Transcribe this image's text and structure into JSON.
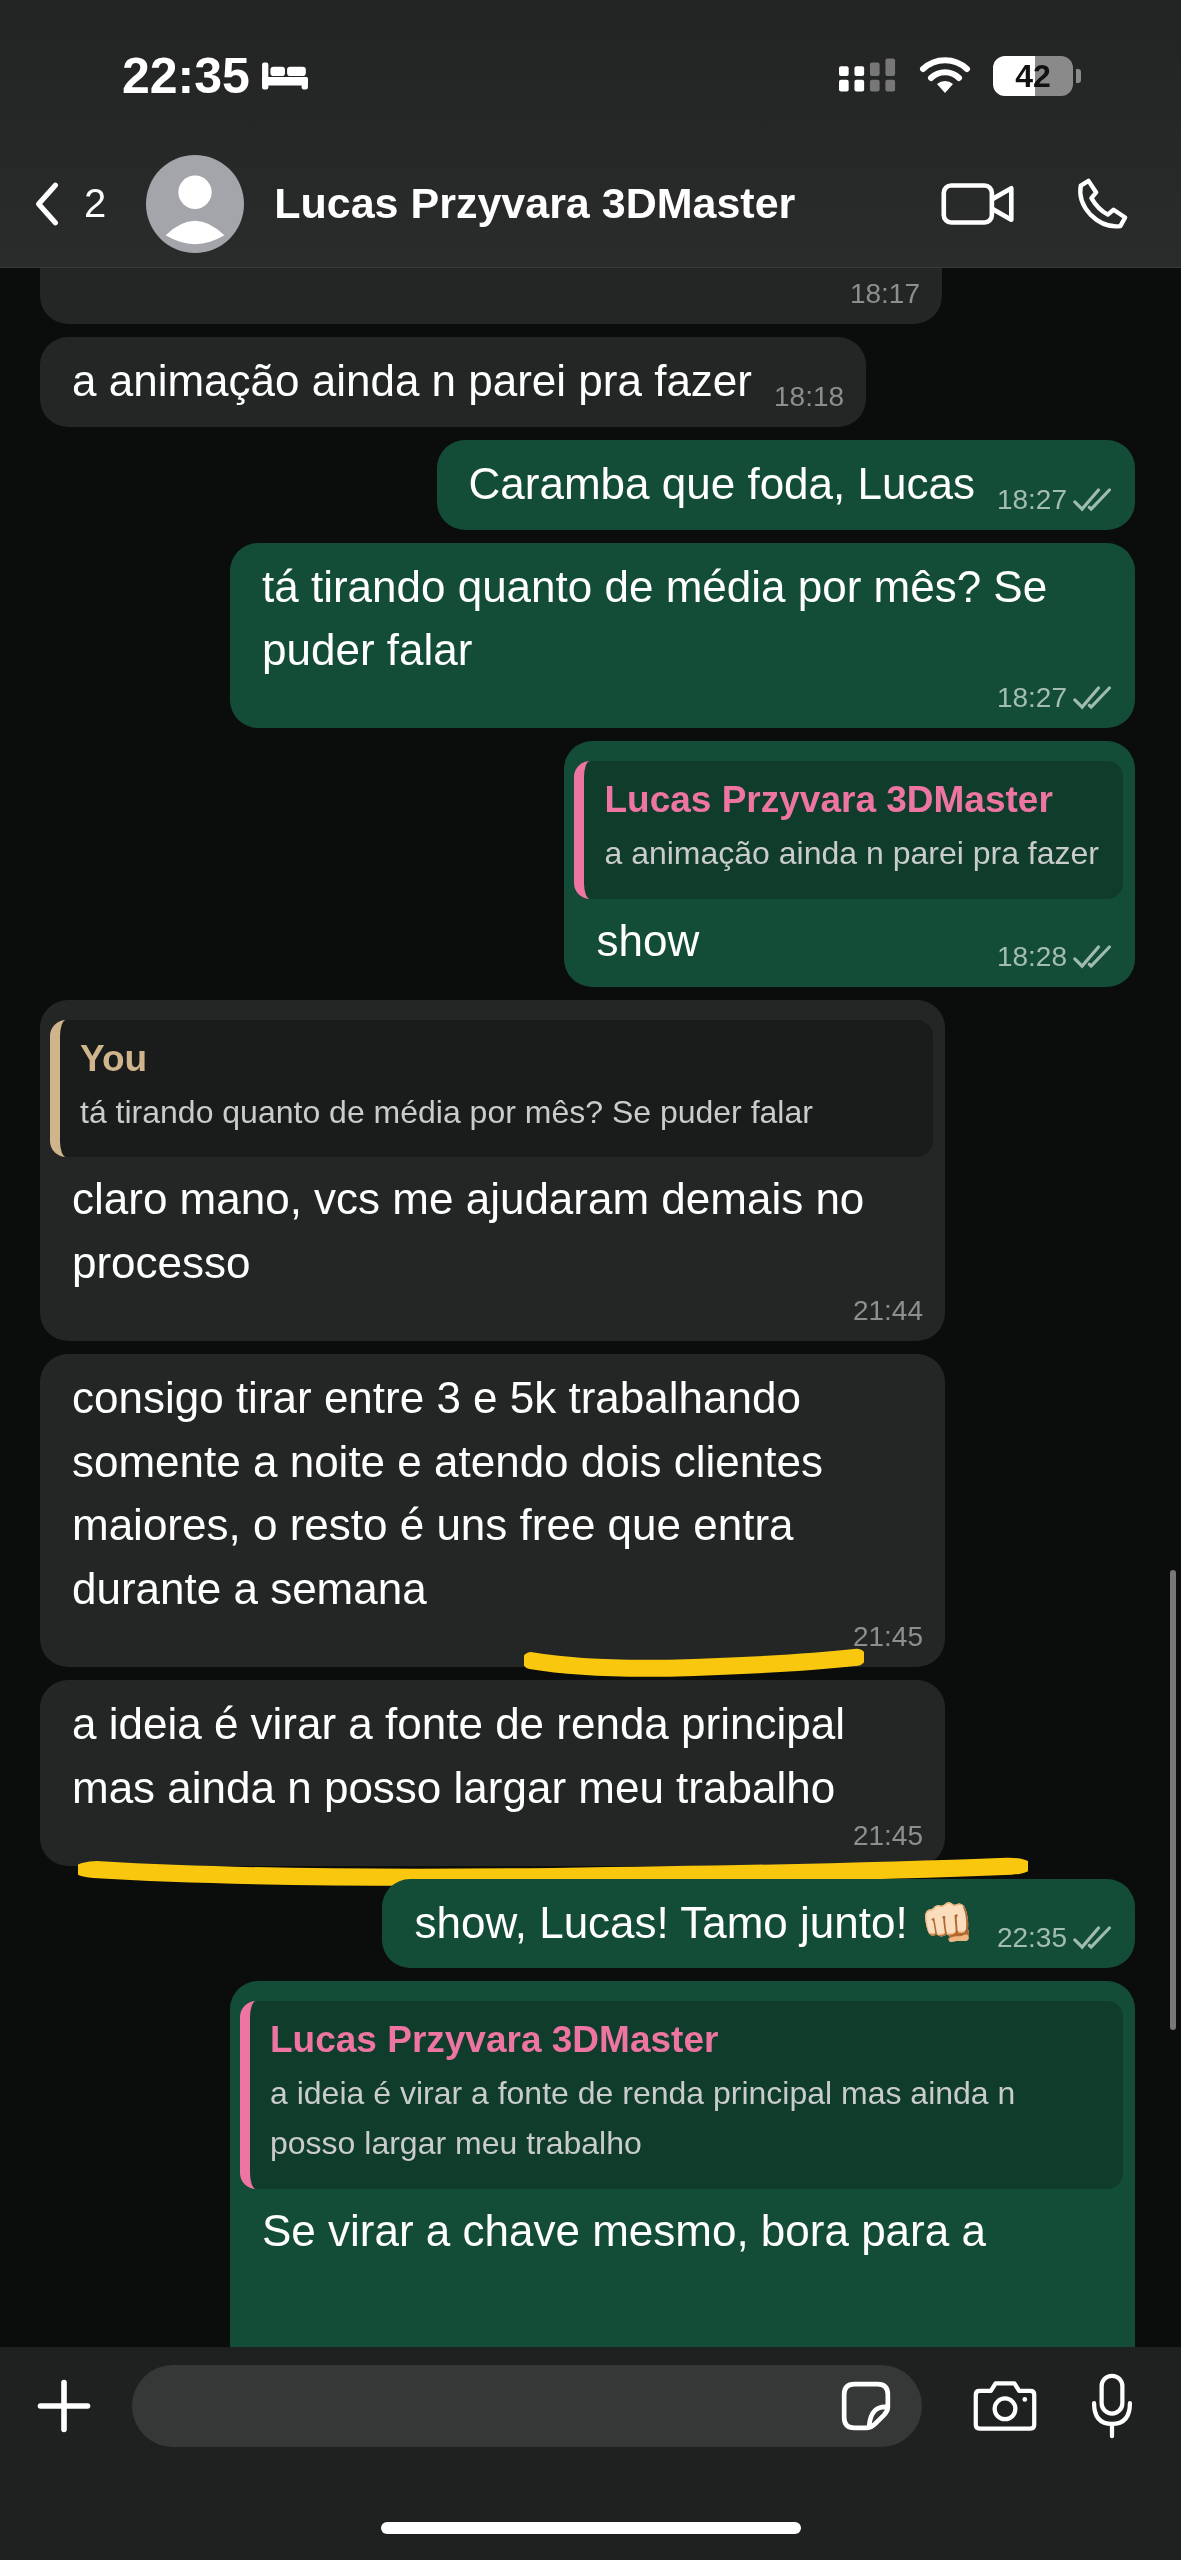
{
  "status_bar": {
    "time": "22:35",
    "battery": "42"
  },
  "header": {
    "back_count": "2",
    "contact_name": "Lucas Przyvara 3DMaster"
  },
  "messages": [
    {
      "outgoing": false,
      "kind": "cut",
      "time": "18:17",
      "highlighted": false
    },
    {
      "outgoing": false,
      "kind": "text",
      "text": "a animação ainda n parei pra fazer",
      "time": "18:18",
      "highlighted": false
    },
    {
      "outgoing": true,
      "kind": "text",
      "text": "Caramba que foda, Lucas",
      "time": "18:27",
      "delivered": true,
      "highlighted": false
    },
    {
      "outgoing": true,
      "kind": "text",
      "text": "tá tirando quanto de média por mês? Se puder falar",
      "time": "18:27",
      "delivered": true,
      "highlighted": false
    },
    {
      "outgoing": true,
      "kind": "reply",
      "reply": {
        "author": "Lucas Przyvara 3DMaster",
        "text": "a animação ainda n parei pra fazer",
        "color": "#ee75a2"
      },
      "text": "show",
      "time": "18:28",
      "delivered": true,
      "highlighted": false
    },
    {
      "outgoing": false,
      "kind": "reply",
      "reply": {
        "author": "You",
        "text": "tá tirando quanto de média por mês? Se puder falar",
        "color": "#d0b48c"
      },
      "text": "claro mano, vcs me ajudaram demais no processo",
      "time": "21:44",
      "highlighted": false
    },
    {
      "outgoing": false,
      "kind": "text",
      "text": "consigo tirar entre 3 e 5k trabalhando somente a noite e atendo dois clientes maiores, o resto é uns free que entra durante a semana",
      "time": "21:45",
      "highlighted": true
    },
    {
      "outgoing": false,
      "kind": "text",
      "text": "a ideia é virar a fonte de renda principal mas ainda n posso largar meu trabalho",
      "time": "21:45",
      "highlighted": true
    },
    {
      "outgoing": true,
      "kind": "text",
      "text": "show, Lucas! Tamo junto! 👊🏻",
      "time": "22:35",
      "delivered": true,
      "highlighted": false
    },
    {
      "outgoing": true,
      "kind": "reply",
      "reply": {
        "author": "Lucas Przyvara 3DMaster",
        "text": "a ideia é virar a fonte de renda principal mas ainda n posso largar meu trabalho",
        "color": "#ee75a2"
      },
      "text": "Se virar a chave mesmo, bora para a",
      "highlighted": false
    }
  ]
}
